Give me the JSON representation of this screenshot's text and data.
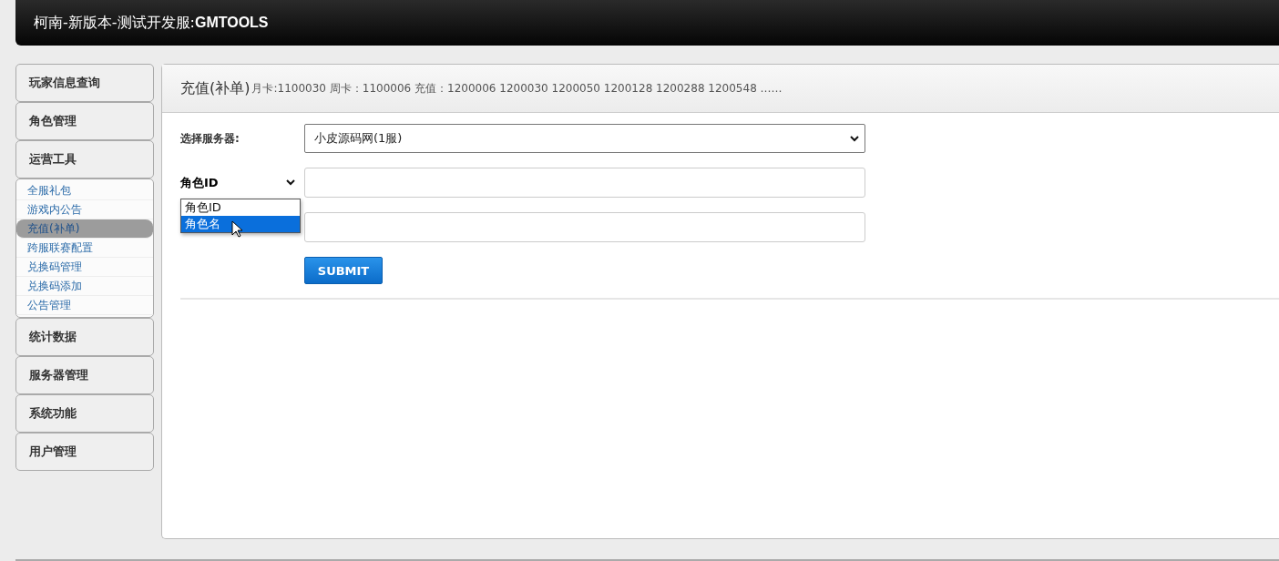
{
  "header": {
    "title": "柯南-新版本-测试开发服:**GMTOOLS**"
  },
  "sidebar": {
    "sections": [
      {
        "label": "玩家信息查询"
      },
      {
        "label": "角色管理"
      },
      {
        "label": "运营工具",
        "children": [
          {
            "label": "全服礼包",
            "selected": false
          },
          {
            "label": "游戏内公告",
            "selected": false
          },
          {
            "label": "充值(补单)",
            "selected": true
          },
          {
            "label": "跨服联赛配置",
            "selected": false
          },
          {
            "label": "兑换码管理",
            "selected": false
          },
          {
            "label": "兑换码添加",
            "selected": false
          },
          {
            "label": "公告管理",
            "selected": false
          }
        ]
      },
      {
        "label": "统计数据"
      },
      {
        "label": "服务器管理"
      },
      {
        "label": "系统功能"
      },
      {
        "label": "用户管理"
      }
    ]
  },
  "panel": {
    "title": "充值(补单)",
    "info": "月卡:1100030 周卡：1100006 充值：1200006 1200030 1200050 1200128 1200288 1200548 ……",
    "form": {
      "server_label": "选择服务器:",
      "server_value": "小皮源码网(1服)",
      "lookup": {
        "value": "角色ID",
        "options": [
          {
            "label": "角色ID",
            "highlighted": false
          },
          {
            "label": "角色名",
            "highlighted": true
          }
        ]
      },
      "submit": "SUBMIT"
    }
  }
}
